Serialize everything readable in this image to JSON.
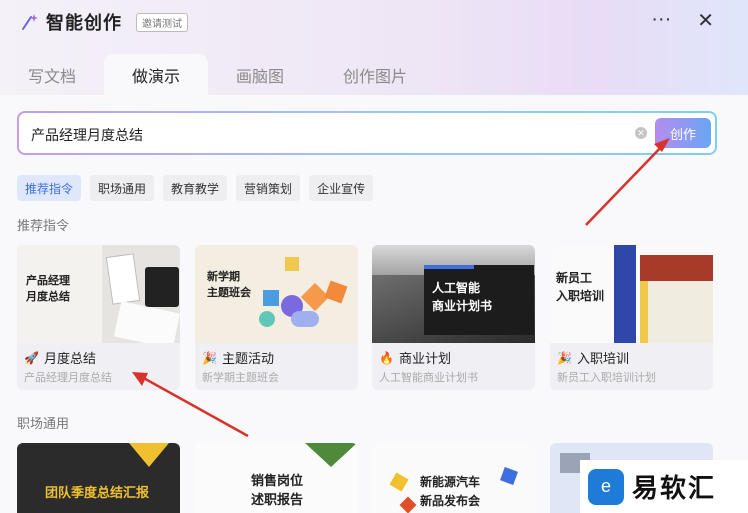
{
  "header": {
    "title": "智能创作",
    "badge": "邀请测试",
    "more": "···",
    "close": "✕"
  },
  "tabs": [
    {
      "label": "写文档"
    },
    {
      "label": "做演示"
    },
    {
      "label": "画脑图"
    },
    {
      "label": "创作图片"
    }
  ],
  "search": {
    "value": "产品经理月度总结",
    "create_label": "创作"
  },
  "chips": [
    {
      "label": "推荐指令"
    },
    {
      "label": "职场通用"
    },
    {
      "label": "教育教学"
    },
    {
      "label": "营销策划"
    },
    {
      "label": "企业宣传"
    }
  ],
  "sections": {
    "recommended": "推荐指令",
    "workplace": "职场通用"
  },
  "cards": [
    {
      "icon": "rocket-icon",
      "title": "月度总结",
      "subtitle": "产品经理月度总结",
      "thumb_text": "产品经理\n月度总结"
    },
    {
      "icon": "party-icon",
      "title": "主题活动",
      "subtitle": "新学期主题班会",
      "thumb_text": "新学期\n主题班会"
    },
    {
      "icon": "fire-icon",
      "title": "商业计划",
      "subtitle": "人工智能商业计划书",
      "thumb_text": "人工智能\n商业计划书"
    },
    {
      "icon": "party-icon",
      "title": "入职培训",
      "subtitle": "新员工入职培训计划",
      "thumb_text": "新员工\n入职培训"
    }
  ],
  "bottom_cards": [
    {
      "thumb_text": "团队季度总结汇报"
    },
    {
      "thumb_text": "销售岗位\n述职报告"
    },
    {
      "thumb_text": "新能源汽车\n新品发布会"
    },
    {
      "thumb_text": ""
    }
  ],
  "watermark": {
    "text": "易软汇"
  }
}
